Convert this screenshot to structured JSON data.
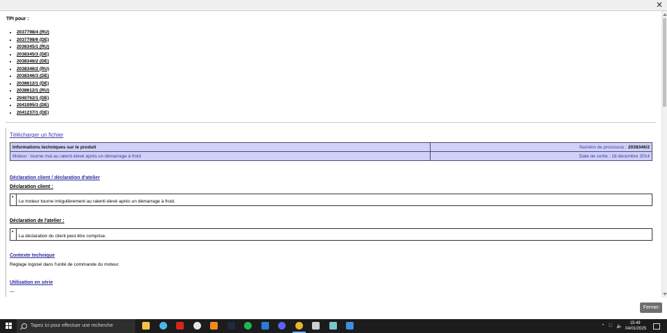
{
  "window": {
    "close_glyph": "✕"
  },
  "tpi": {
    "title": "TPI pour :",
    "items": [
      "2037798/4 (RU)",
      "2037798/6 (DE)",
      "2038345/1 (RU)",
      "2038345/3 (DE)",
      "2038346/2 (DE)",
      "2038346/2 (RU)",
      "2038346/3 (DE)",
      "2038612/1 (DE)",
      "2038612/1 (RU)",
      "2040762/1 (DE)",
      "2041095/3 (DE)",
      "2041237/1 (DE)"
    ]
  },
  "download_link": "Télécharger un fichier",
  "product_info": {
    "header": "Informations techniques sur le produit",
    "process_label": "Numéro de processus :",
    "process_number": "2038346/2",
    "subject": "Moteur : tourne mal au ralenti élevé après un démarrage à froid",
    "release_label": "Date de sortie :",
    "release_date": "18 décembre 2014"
  },
  "sections": {
    "declarations_title": "Déclaration client / déclaration d'atelier",
    "client_title": "Déclaration client :",
    "client_text": "Le moteur tourne irrégulièrement au ralenti élevé après un démarrage à froid.",
    "workshop_title": "Déclaration de l'atelier :",
    "workshop_text": "La déclaration du client peut être comprise.",
    "context_title": "Contexte technique",
    "context_text": "Réglage logiciel dans l'unité de commande du moteur.",
    "series_title": "Utilisation en série",
    "series_text": "—",
    "bullet": "•"
  },
  "buttons": {
    "close": "Fermer"
  },
  "taskbar": {
    "search_placeholder": "Tapez ici pour effectuer une recherche",
    "time": "15:49",
    "date": "04/01/2025",
    "app_icons": [
      {
        "name": "file-explorer-icon",
        "color": "#f2c443"
      },
      {
        "name": "maps-icon",
        "color": "#4db6e8"
      },
      {
        "name": "acrobat-icon",
        "color": "#d9261c"
      },
      {
        "name": "app-s-icon",
        "color": "#e6e6e6"
      },
      {
        "name": "vlc-icon",
        "color": "#f08a1c"
      },
      {
        "name": "lightroom-icon",
        "color": "#1e2a40"
      },
      {
        "name": "spotify-icon",
        "color": "#1db954"
      },
      {
        "name": "notes-icon",
        "color": "#2a7cd6"
      },
      {
        "name": "discord-icon",
        "color": "#5865f2"
      },
      {
        "name": "chrome-icon",
        "color": "#e9b52a"
      },
      {
        "name": "settings-tool-icon",
        "color": "#cfcfcf"
      },
      {
        "name": "stack-app-icon",
        "color": "#7ac5c9"
      },
      {
        "name": "photo-app-icon",
        "color": "#3f8ee0"
      }
    ]
  }
}
